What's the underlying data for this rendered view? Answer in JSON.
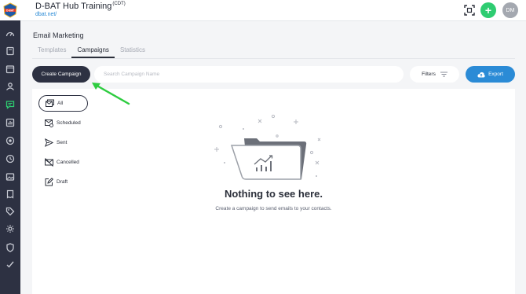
{
  "app": {
    "title": "D-BAT Hub Training",
    "timezone": "(CDT)",
    "link": "dbat.net/",
    "avatar_initials": "DM",
    "add_glyph": "+",
    "logo_text": "D-BAT"
  },
  "page": {
    "title": "Email Marketing",
    "tabs": [
      {
        "label": "Templates",
        "active": false
      },
      {
        "label": "Campaigns",
        "active": true
      },
      {
        "label": "Statistics",
        "active": false
      }
    ]
  },
  "toolbar": {
    "create_label": "Create Campaign",
    "search_placeholder": "Search Campaign Name",
    "filters_label": "Filters",
    "export_label": "Export"
  },
  "filters": [
    {
      "label": "All",
      "icon": "all-mail-icon",
      "active": true
    },
    {
      "label": "Scheduled",
      "icon": "scheduled-mail-icon",
      "active": false
    },
    {
      "label": "Sent",
      "icon": "send-icon",
      "active": false
    },
    {
      "label": "Cancelled",
      "icon": "cancelled-mail-icon",
      "active": false
    },
    {
      "label": "Draft",
      "icon": "edit-icon",
      "active": false
    }
  ],
  "empty_state": {
    "title": "Nothing to see here.",
    "subtitle": "Create a campaign to send emails to your contacts."
  },
  "sidebar": {
    "items": [
      "dashboard-icon",
      "book-icon",
      "calendar-icon",
      "users-icon",
      "message-icon",
      "reports-icon",
      "target-icon",
      "clock-icon",
      "image-icon",
      "receipt-icon",
      "tag-icon",
      "tags-icon",
      "settings-icon",
      "shield-icon",
      "check-edit-icon"
    ],
    "active_index": 4
  },
  "colors": {
    "sidebar_bg": "#2d3142",
    "accent_blue": "#2b8bd6",
    "accent_green": "#2ecc71",
    "active_sidebar_icon": "#2ecc71",
    "annotation_arrow": "#2ecc40"
  }
}
